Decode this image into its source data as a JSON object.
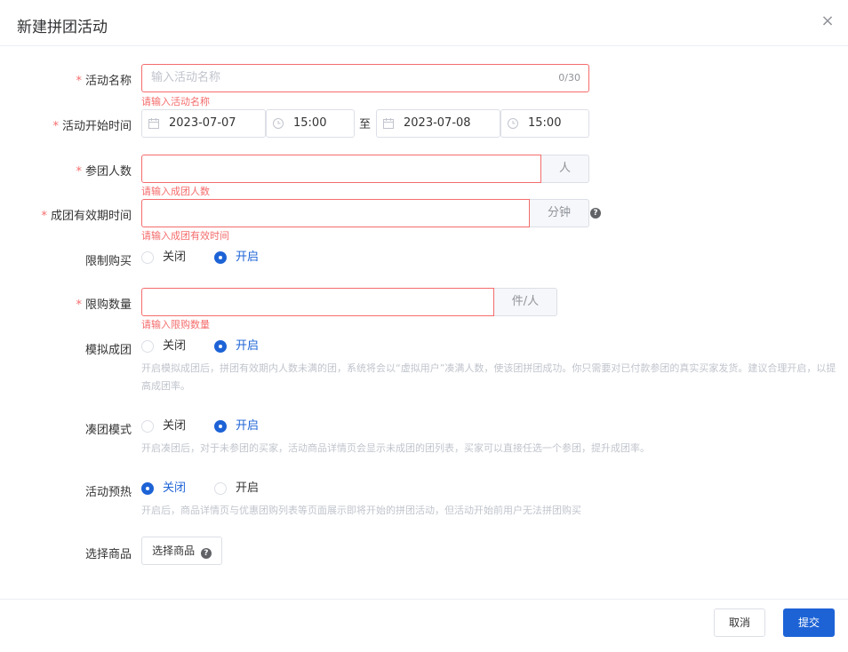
{
  "dialog": {
    "title": "新建拼团活动",
    "close_icon": "×"
  },
  "form": {
    "name": {
      "label": "活动名称",
      "placeholder": "输入活动名称",
      "counter": "0/30",
      "error": "请输入活动名称"
    },
    "start_time": {
      "label": "活动开始时间",
      "start_date": "2023-07-07",
      "start_time": "15:00",
      "separator": "至",
      "end_date": "2023-07-08",
      "end_time": "15:00"
    },
    "group_size": {
      "label": "参团人数",
      "value": "",
      "unit": "人",
      "error": "请输入成团人数"
    },
    "validity": {
      "label": "成团有效期时间",
      "value": "",
      "unit": "分钟",
      "error": "请输入成团有效时间"
    },
    "purchase_limit": {
      "label": "限制购买",
      "options": [
        "关闭",
        "开启"
      ],
      "selected": "开启"
    },
    "limit_qty": {
      "label": "限购数量",
      "value": "",
      "unit": "件/人",
      "error": "请输入限购数量"
    },
    "simulate": {
      "label": "模拟成团",
      "options": [
        "关闭",
        "开启"
      ],
      "selected": "开启",
      "help": "开启模拟成团后，拼团有效期内人数未满的团，系统将会以“虚拟用户”凑满人数，使该团拼团成功。你只需要对已付款参团的真实买家发货。建议合理开启，以提高成团率。"
    },
    "gather": {
      "label": "凑团模式",
      "options": [
        "关闭",
        "开启"
      ],
      "selected": "开启",
      "help": "开启凑团后，对于未参团的买家，活动商品详情页会显示未成团的团列表，买家可以直接任选一个参团，提升成团率。"
    },
    "preheat": {
      "label": "活动预热",
      "options": [
        "关闭",
        "开启"
      ],
      "selected": "关闭",
      "help": "开启后，商品详情页与优惠团购列表等页面展示即将开始的拼团活动，但活动开始前用户无法拼团购买"
    },
    "product": {
      "label": "选择商品",
      "button": "选择商品"
    }
  },
  "footer": {
    "cancel": "取消",
    "submit": "提交"
  },
  "colors": {
    "primary": "#1d63d6",
    "error": "#f56c6c"
  }
}
